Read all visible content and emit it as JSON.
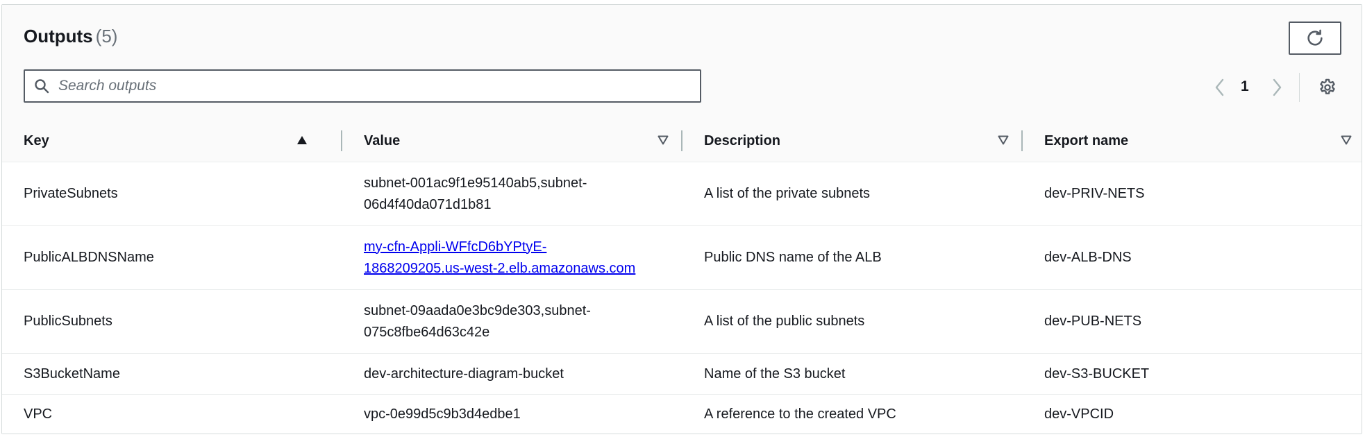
{
  "outputs": {
    "title": "Outputs",
    "count": "(5)",
    "search_placeholder": "Search outputs",
    "page": "1",
    "columns": {
      "key": "Key",
      "value": "Value",
      "description": "Description",
      "export_name": "Export name"
    },
    "rows": [
      {
        "key": "PrivateSubnets",
        "value_lines": [
          "subnet-001ac9f1e95140ab5,subnet-",
          "06d4f40da071d1b81"
        ],
        "description": "A list of the private subnets",
        "export_name": "dev-PRIV-NETS"
      },
      {
        "key": "PublicALBDNSName",
        "value_lines": [
          "my-cfn-Appli-WFfcD6bYPtyE-",
          "1868209205.us-west-2.elb.amazonaws.com"
        ],
        "description": "Public DNS name of the ALB",
        "export_name": "dev-ALB-DNS"
      },
      {
        "key": "PublicSubnets",
        "value_lines": [
          "subnet-09aada0e3bc9de303,subnet-",
          "075c8fbe64d63c42e"
        ],
        "description": "A list of the public subnets",
        "export_name": "dev-PUB-NETS"
      },
      {
        "key": "S3BucketName",
        "value_lines": [
          "dev-architecture-diagram-bucket"
        ],
        "description": "Name of the S3 bucket",
        "export_name": "dev-S3-BUCKET"
      },
      {
        "key": "VPC",
        "value_lines": [
          "vpc-0e99d5c9b3d4edbe1"
        ],
        "description": "A reference to the created VPC",
        "export_name": "dev-VPCID"
      }
    ]
  },
  "icons": {
    "refresh": "refresh-icon",
    "search": "search-icon",
    "prev": "chevron-left-icon",
    "next": "chevron-right-icon",
    "settings": "gear-icon",
    "sort_asc": "caret-up-filled-icon",
    "sort_none": "caret-down-outline-icon"
  },
  "colors": {
    "link": "#0000ee",
    "text": "#16191f",
    "muted": "#687078",
    "border": "#545b64"
  }
}
